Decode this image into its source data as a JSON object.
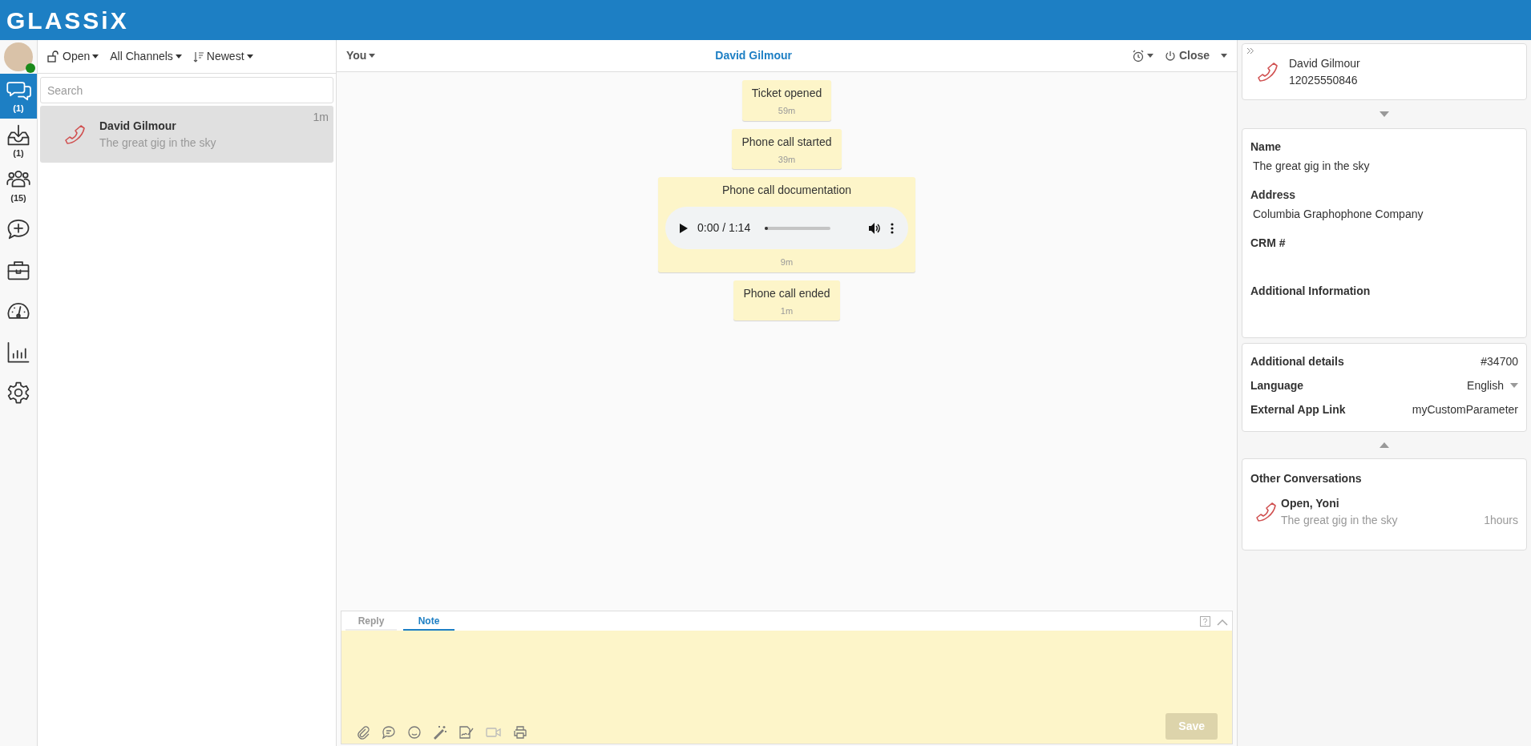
{
  "app": {
    "logo": "GLASSiX"
  },
  "nav": [
    {
      "badge": "(1)",
      "selected": true
    },
    {
      "badge": "(1)",
      "selected": false
    },
    {
      "badge": "(15)",
      "selected": false
    },
    {
      "selected": false
    },
    {
      "selected": false
    },
    {
      "selected": false
    },
    {
      "selected": false
    },
    {
      "selected": false
    }
  ],
  "list_toolbar": {
    "status": "Open",
    "channels": "All Channels",
    "sort": "Newest"
  },
  "search": {
    "placeholder": "Search"
  },
  "conversations": [
    {
      "name": "David Gilmour",
      "preview": "The great gig in the sky",
      "time": "1m",
      "selected": true
    }
  ],
  "chat_header": {
    "assignee": "You",
    "title": "David Gilmour",
    "close": "Close"
  },
  "messages": [
    {
      "kind": "event",
      "text": "Ticket opened",
      "time": "59m"
    },
    {
      "kind": "event",
      "text": "Phone call started",
      "time": "39m"
    },
    {
      "kind": "audio",
      "text": "Phone call documentation",
      "player_time": "0:00 / 1:14",
      "level": 0.02,
      "time": "9m"
    },
    {
      "kind": "event",
      "text": "Phone call ended",
      "time": "1m"
    }
  ],
  "composer": {
    "tabs": [
      {
        "label": "Reply",
        "selected": false
      },
      {
        "label": "Note",
        "selected": true
      }
    ],
    "save": "Save",
    "save_disabled": true
  },
  "contact": {
    "name": "David Gilmour",
    "phone": "12025550846"
  },
  "fields": [
    {
      "label": "Name",
      "value": "The great gig in the sky"
    },
    {
      "label": "Address",
      "value": "Columbia Graphophone Company"
    },
    {
      "label": "CRM #"
    },
    {
      "label": "Additional Information"
    }
  ],
  "details": [
    {
      "kind": "text",
      "label": "Additional details",
      "value": "#34700"
    },
    {
      "kind": "dropdown",
      "label": "Language",
      "value": "English"
    },
    {
      "kind": "text",
      "label": "External App Link",
      "value": "myCustomParameter"
    }
  ],
  "other_conversations": {
    "title": "Other Conversations",
    "items": [
      {
        "name": "Open, Yoni",
        "preview": "The great gig in the sky",
        "time": "1hours"
      }
    ]
  }
}
